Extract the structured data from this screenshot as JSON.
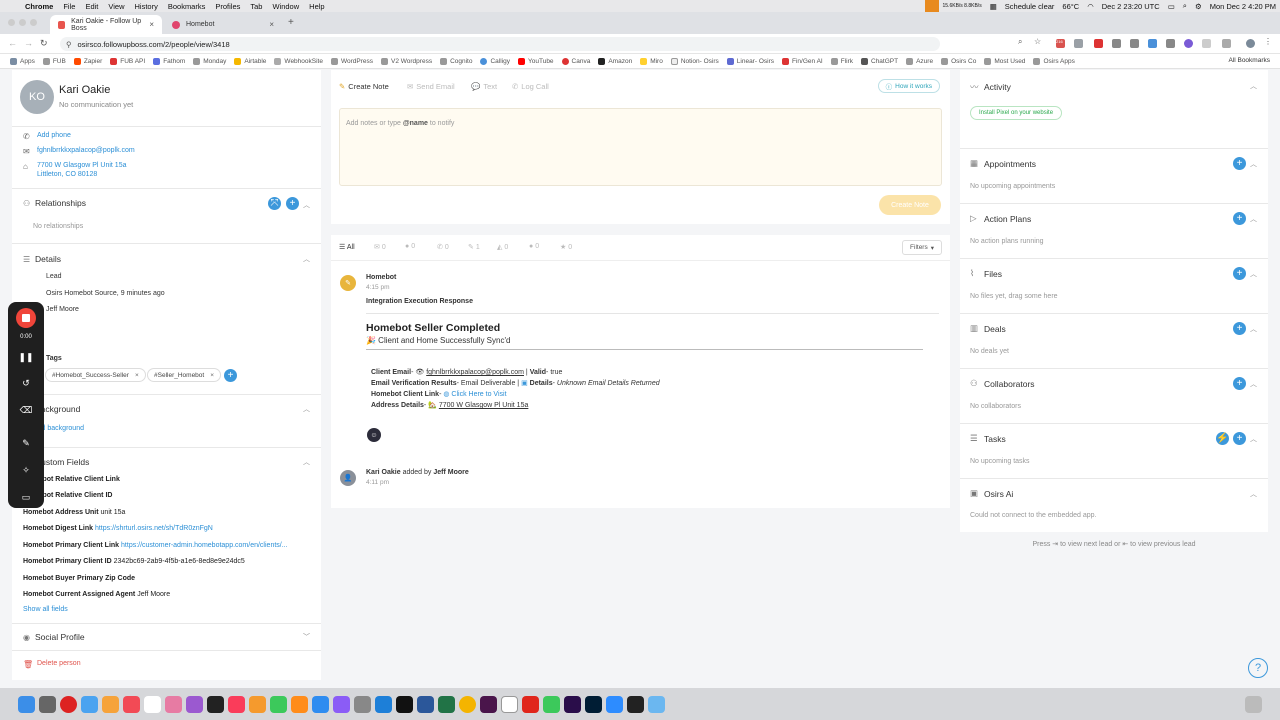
{
  "menubar": {
    "items": [
      "Chrome",
      "File",
      "Edit",
      "View",
      "History",
      "Bookmarks",
      "Profiles",
      "Tab",
      "Window",
      "Help"
    ],
    "status": {
      "net": "15.6KB/s 8.8KB/s",
      "schedule": "Schedule clear",
      "temp": "66°C",
      "date_utc": "Dec 2 23:20 UTC",
      "clock": "Mon Dec 2 4:20 PM"
    }
  },
  "browser": {
    "tabs": [
      {
        "label": "Kari Oakie - Follow Up Boss"
      },
      {
        "label": "Homebot"
      }
    ],
    "url": "osirsco.followupboss.com/2/people/view/3418",
    "ext_badge": "216",
    "bookmarks": [
      "Apps",
      "FUB",
      "Zapier",
      "FUB API",
      "Fathom",
      "Monday",
      "Airtable",
      "WebhookSite",
      "WordPress",
      "V2 Wordpress",
      "Cognito",
      "Calligy",
      "YouTube",
      "Canva",
      "Amazon",
      "Miro",
      "Notion- Osirs",
      "Linear- Osirs",
      "Fin/Gen AI",
      "Flirk",
      "ChatGPT",
      "Azure",
      "Osirs Co",
      "Most Used",
      "Osirs Apps"
    ],
    "all_bookmarks": "All Bookmarks"
  },
  "person": {
    "initials": "KO",
    "name": "Kari Oakie",
    "comm_status": "No communication yet",
    "add_phone": "Add phone",
    "email": "fghnlbrrkkxpalacop@poplk.com",
    "address_line1": "7700 W Glasgow Pl Unit 15a",
    "address_line2": "Littleton, CO 80128"
  },
  "relationships": {
    "title": "Relationships",
    "empty": "No relationships"
  },
  "details": {
    "title": "Details",
    "stage": "Lead",
    "source": "Osirs Homebot Source, 9 minutes ago",
    "agent": "Jeff Moore",
    "tags_label": "Tags",
    "tags": [
      "#Homebot_Success-Seller",
      "#Seller_Homebot"
    ]
  },
  "background": {
    "title": "Background",
    "add": "Add background"
  },
  "custom_fields": {
    "title": "Custom Fields",
    "fields": [
      {
        "label": "Homebot Relative Client Link",
        "value": ""
      },
      {
        "label": "Homebot Relative Client ID",
        "value": ""
      },
      {
        "label": "Homebot Address Unit",
        "value": "unit 15a"
      },
      {
        "label": "Homebot Digest Link",
        "value": "https://shrturl.osirs.net/sh/TdR0znFgN"
      },
      {
        "label": "Homebot Primary Client Link",
        "value": "https://customer-admin.homebotapp.com/en/clients/..."
      },
      {
        "label": "Homebot Primary Client ID",
        "value": "2342bc69-2ab9-4f5b-a1e6-8ed8e9e24dc5"
      },
      {
        "label": "Homebot Buyer Primary Zip Code",
        "value": ""
      },
      {
        "label": "Homebot Current Assigned Agent",
        "value": "Jeff Moore"
      }
    ],
    "show_all": "Show all fields"
  },
  "social": {
    "title": "Social Profile"
  },
  "delete_label": "Delete person",
  "recorder": {
    "time": "0:00"
  },
  "note": {
    "tabs": [
      "Create Note",
      "Send Email",
      "Text",
      "Log Call"
    ],
    "how": "How it works",
    "placeholder_pre": "Add notes or type ",
    "placeholder_mention": "@name",
    "placeholder_post": " to notify",
    "create": "Create Note"
  },
  "feed": {
    "tabs": [
      {
        "label": "All",
        "count": ""
      },
      {
        "label": "email",
        "count": "0"
      },
      {
        "label": "text",
        "count": "0"
      },
      {
        "label": "call",
        "count": "0"
      },
      {
        "label": "note",
        "count": "1"
      },
      {
        "label": "event",
        "count": "0"
      },
      {
        "label": "appointment",
        "count": "0"
      },
      {
        "label": "star",
        "count": "0"
      }
    ],
    "filters": "Filters",
    "event1": {
      "source": "Homebot",
      "time": "4:15 pm",
      "type": "Integration Execution Response",
      "title": "Homebot Seller Completed",
      "subtitle": "🎉 Client and Home Successfully Sync'd",
      "client_email_label": "Client Email",
      "client_email_value": "fghnlbrrkkxpalacop@poplk.com",
      "valid": "Valid",
      "valid_value": "true",
      "verif_label": "Email Verification Results",
      "verif_value": "Email Deliverable",
      "details_label": "Details",
      "details_value": "Unknown Email Details Returned",
      "link_label": "Homebot Client Link",
      "link_value": "Click Here to Visit",
      "addr_label": "Address Details",
      "addr_value": "7700 W Glasgow Pl Unit 15a"
    },
    "event2": {
      "who": "Kari Oakie",
      "mid": "added by",
      "by": "Jeff Moore",
      "time": "4:11 pm"
    }
  },
  "right": {
    "activity": "Activity",
    "pixel": "Install Pixel on your website",
    "sections": [
      {
        "title": "Appointments",
        "empty": "No upcoming appointments"
      },
      {
        "title": "Action Plans",
        "empty": "No action plans running"
      },
      {
        "title": "Files",
        "empty": "No files yet, drag some here"
      },
      {
        "title": "Deals",
        "empty": "No deals yet"
      },
      {
        "title": "Collaborators",
        "empty": "No collaborators"
      },
      {
        "title": "Tasks",
        "empty": "No upcoming tasks"
      },
      {
        "title": "Osirs Ai",
        "empty": "Could not connect to the embedded app."
      }
    ],
    "hint": "Press ⇥ to view next lead or ⇤ to view previous lead"
  },
  "colors": {
    "accent": "#3c98db",
    "record": "#f0453a",
    "note_bg": "#fffbf1",
    "create_btn": "#fbe3a9"
  }
}
